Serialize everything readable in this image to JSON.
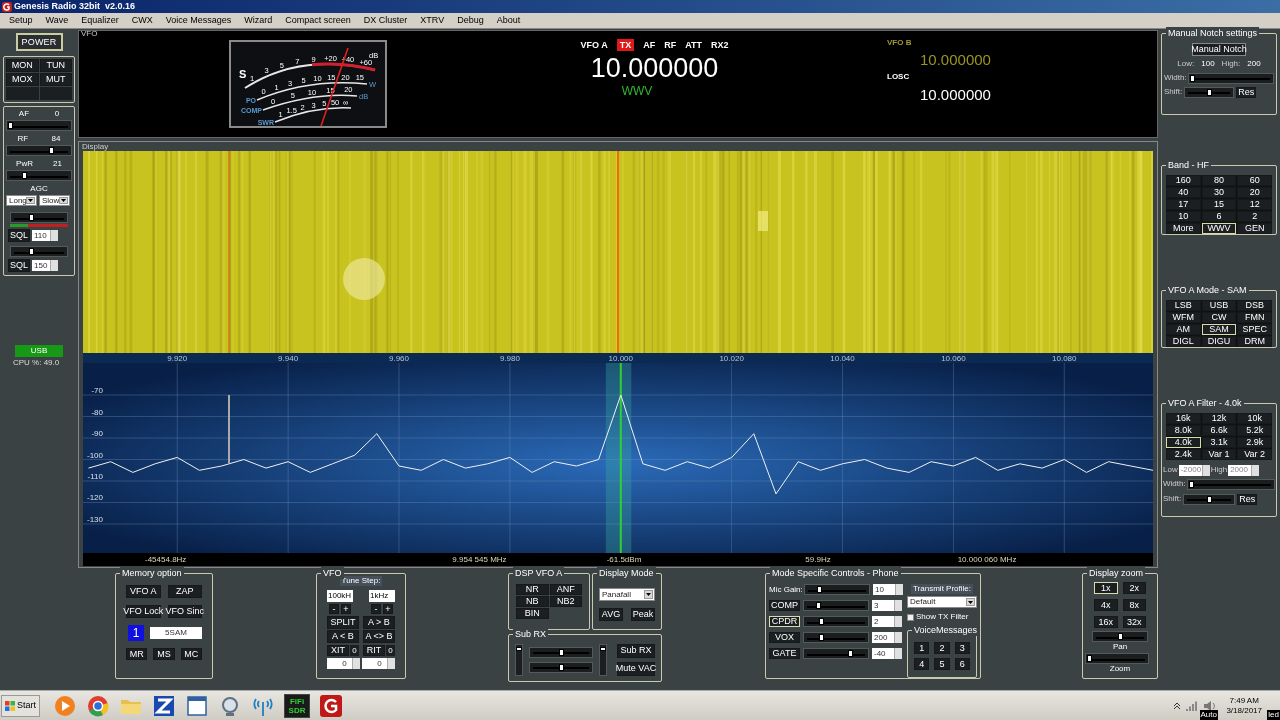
{
  "window": {
    "title": "Genesis Radio 32bit  v2.0.16"
  },
  "menu": [
    "Setup",
    "Wave",
    "Equalizer",
    "CWX",
    "Voice Messages",
    "Wizard",
    "Compact screen",
    "DX Cluster",
    "XTRV",
    "Debug",
    "About"
  ],
  "left_panel": {
    "power": "POWER",
    "buttons": [
      "MON",
      "TUN",
      "MOX",
      "MUT"
    ],
    "sliders": [
      {
        "label": "AF",
        "reading": "0",
        "level": 0.02
      },
      {
        "label": "RF",
        "reading": "84",
        "level": 0.72
      },
      {
        "label": "PwR",
        "reading": "21",
        "level": 0.25
      }
    ],
    "agc": {
      "label": "AGC",
      "mode": "Long",
      "speed": "Slow"
    },
    "squelch": [
      {
        "label": "SQL",
        "value": "110",
        "level": 0.35
      },
      {
        "label": "SQL",
        "value": "150",
        "level": 0.35
      }
    ],
    "mode_badge": "USB",
    "cpu": "CPU %: 49.0"
  },
  "vfo": {
    "label": "VFO",
    "meter": {
      "scales": [
        {
          "label": "S",
          "marks": [
            "1",
            "3",
            "5",
            "7",
            "9",
            "+20",
            "+40",
            "+60"
          ],
          "unit": "dB"
        },
        {
          "label": "PO",
          "marks": [
            "0",
            "1",
            "3",
            "5",
            "10",
            "15",
            "20",
            "15"
          ],
          "unit": "W"
        },
        {
          "label": "COMP",
          "marks": [
            "0",
            "5",
            "10",
            "15",
            "20"
          ],
          "unit": "dB"
        },
        {
          "label": "SWR",
          "marks": [
            "1",
            "1.5",
            "2",
            "3",
            "5",
            "50",
            "∞"
          ]
        }
      ]
    },
    "indicators": [
      {
        "label": "VFO A",
        "on": false
      },
      {
        "label": "TX",
        "on": true
      },
      {
        "label": "AF",
        "on": false
      },
      {
        "label": "RF",
        "on": false
      },
      {
        "label": "ATT",
        "on": false
      },
      {
        "label": "RX2",
        "on": false
      }
    ],
    "frequency": "10.000000",
    "station": "WWV",
    "vfo_b_label": "VFO B",
    "vfo_b_frequency": "10.000000",
    "losc_label": "LOSC",
    "losc_frequency": "10.000000"
  },
  "display": {
    "label": "Display",
    "chart_data": {
      "type": "line",
      "grid": true,
      "bands": [
        {
          "axis": "x",
          "from": 9.9973,
          "to": 10.0019,
          "color": "#3aa8a0"
        }
      ],
      "ref_lines": [
        {
          "axis": "x",
          "value": 10.0,
          "color": "#30d030"
        }
      ],
      "xlim": [
        9.903,
        10.096
      ],
      "ylim": [
        -143.5,
        -55.1
      ],
      "xticks": [
        {
          "value": 9.92,
          "label": "9.920"
        },
        {
          "value": 9.94,
          "label": "9.940"
        },
        {
          "value": 9.96,
          "label": "9.960"
        },
        {
          "value": 9.98,
          "label": "9.980"
        },
        {
          "value": 10.0,
          "label": "10.000"
        },
        {
          "value": 10.02,
          "label": "10.020"
        },
        {
          "value": 10.04,
          "label": "10.040"
        },
        {
          "value": 10.06,
          "label": "10.060"
        },
        {
          "value": 10.08,
          "label": "10.080"
        }
      ],
      "yticks": [
        -70,
        -80,
        -90,
        -100,
        -110,
        -120,
        -130
      ],
      "x": [
        9.904,
        9.908,
        9.912,
        9.916,
        9.92,
        9.924,
        9.928,
        9.932,
        9.936,
        9.94,
        9.944,
        9.948,
        9.952,
        9.956,
        9.96,
        9.964,
        9.968,
        9.972,
        9.976,
        9.98,
        9.984,
        9.988,
        9.992,
        9.996,
        10.0,
        10.004,
        10.008,
        10.012,
        10.016,
        10.02,
        10.024,
        10.028,
        10.032,
        10.036,
        10.04,
        10.044,
        10.048,
        10.052,
        10.056,
        10.06,
        10.064,
        10.068,
        10.072,
        10.076,
        10.08,
        10.084,
        10.088,
        10.092,
        10.096
      ],
      "series": [
        {
          "color": "#f0f0f0",
          "values": [
            -104,
            -101,
            -106,
            -102,
            -99,
            -105,
            -103,
            -100,
            -104,
            -101,
            -106,
            -102,
            -98,
            -88,
            -103,
            -105,
            -100,
            -104,
            -102,
            -99,
            -106,
            -101,
            -103,
            -100,
            -70,
            -102,
            -105,
            -101,
            -104,
            -99,
            -88,
            -116,
            -101,
            -105,
            -102,
            -100,
            -104,
            -106,
            -101,
            -103,
            -99,
            -105,
            -102,
            -104,
            -100,
            -106,
            -101,
            -103,
            -105
          ]
        }
      ]
    },
    "readouts": [
      "-45454.8Hz",
      "9.954 545 MHz",
      "-61.5dBm",
      "59.9Hz",
      "10.000 060 MHz"
    ]
  },
  "notch": {
    "title": "Manual Notch settings",
    "button": "Manual Notch",
    "low_label": "Low:",
    "low": "100",
    "high_label": "High:",
    "high": "200",
    "width": {
      "label": "Width:",
      "level": 0.02
    },
    "shift": {
      "label": "Shift:",
      "level": 0.5
    },
    "res": "Res"
  },
  "band": {
    "title": "Band - HF",
    "items": [
      {
        "label": "160",
        "selected": false
      },
      {
        "label": "80",
        "selected": false
      },
      {
        "label": "60",
        "selected": false
      },
      {
        "label": "40",
        "selected": false
      },
      {
        "label": "30",
        "selected": false
      },
      {
        "label": "20",
        "selected": false
      },
      {
        "label": "17",
        "selected": false
      },
      {
        "label": "15",
        "selected": false
      },
      {
        "label": "12",
        "selected": false
      },
      {
        "label": "10",
        "selected": false
      },
      {
        "label": "6",
        "selected": false
      },
      {
        "label": "2",
        "selected": false
      },
      {
        "label": "More",
        "selected": false
      },
      {
        "label": "WWV",
        "selected": true
      },
      {
        "label": "GEN",
        "selected": false
      }
    ]
  },
  "mode": {
    "title": "VFO A Mode - SAM",
    "items": [
      {
        "label": "LSB",
        "selected": false
      },
      {
        "label": "USB",
        "selected": false
      },
      {
        "label": "DSB",
        "selected": false
      },
      {
        "label": "WFM",
        "selected": false
      },
      {
        "label": "CW",
        "selected": false
      },
      {
        "label": "FMN",
        "selected": false
      },
      {
        "label": "AM",
        "selected": false
      },
      {
        "label": "SAM",
        "selected": true
      },
      {
        "label": "SPEC",
        "selected": false
      },
      {
        "label": "DIGL",
        "selected": false
      },
      {
        "label": "DIGU",
        "selected": false
      },
      {
        "label": "DRM",
        "selected": false
      }
    ]
  },
  "filter": {
    "title": "VFO A Filter - 4.0k",
    "items": [
      {
        "label": "16k",
        "selected": false
      },
      {
        "label": "12k",
        "selected": false
      },
      {
        "label": "10k",
        "selected": false
      },
      {
        "label": "8.0k",
        "selected": false
      },
      {
        "label": "6.6k",
        "selected": false
      },
      {
        "label": "5.2k",
        "selected": false
      },
      {
        "label": "4.0k",
        "selected": true
      },
      {
        "label": "3.1k",
        "selected": false
      },
      {
        "label": "2.9k",
        "selected": false
      },
      {
        "label": "2.4k",
        "selected": false
      },
      {
        "label": "Var 1",
        "selected": false
      },
      {
        "label": "Var 2",
        "selected": false
      }
    ],
    "low_label": "Low",
    "low": "-2000",
    "high_label": "High",
    "high": "2000",
    "width": {
      "label": "Width:",
      "level": 0.02
    },
    "shift": {
      "label": "Shift:",
      "level": 0.5
    },
    "res": "Res"
  },
  "memory": {
    "title": "Memory option",
    "buttons": [
      "VFO A",
      "ZAP",
      "VFO Lock",
      "VFO Sinc"
    ],
    "channel": "1",
    "name": "5SAM",
    "bottom_buttons": [
      "MR",
      "MS",
      "MC"
    ]
  },
  "vfo_controls": {
    "title": "VFO",
    "tune_step_label": "Tune Step:",
    "steps": [
      "100kH",
      "1kHz"
    ],
    "step_buttons": [
      "-",
      "+",
      "-",
      "+"
    ],
    "buttons": [
      "SPLIT",
      "A > B",
      "A < B",
      "A <> B"
    ],
    "offsets": [
      {
        "label": "XIT",
        "reading": "0",
        "value": "0"
      },
      {
        "label": "RIT",
        "reading": "0",
        "value": "0"
      }
    ]
  },
  "dsp": {
    "title": "DSP VFO A",
    "buttons": [
      "NR",
      "ANF",
      "NB",
      "NB2",
      "BIN"
    ]
  },
  "display_mode": {
    "title": "Display Mode",
    "value": "Panafall",
    "buttons": [
      "AVG",
      "Peak"
    ]
  },
  "sub_rx": {
    "title": "Sub RX",
    "vertical_sliders": [
      {
        "level": 0.9
      },
      {
        "level": 0.9
      }
    ],
    "horizontal_sliders": [
      {
        "level": 0.5
      },
      {
        "level": 0.5
      }
    ],
    "buttons": [
      "Sub RX",
      "Mute VAC"
    ]
  },
  "mode_controls": {
    "title": "Mode Specific Controls - Phone",
    "rows": [
      {
        "kind": "label",
        "label": "Mic Gain:",
        "level": 0.2,
        "value": "10"
      },
      {
        "kind": "button",
        "label": "COMP",
        "selected": false,
        "level": 0.2,
        "value": "3"
      },
      {
        "kind": "button",
        "label": "CPDR",
        "selected": true,
        "level": 0.25,
        "value": "2"
      },
      {
        "kind": "button",
        "label": "VOX",
        "selected": false,
        "level": 0.25,
        "value": "200"
      },
      {
        "kind": "button",
        "label": "GATE",
        "selected": false,
        "level": 0.75,
        "value": "-40"
      }
    ],
    "profile_label": "Transmit Profile:",
    "profile": "Default",
    "show_tx_filter": {
      "label": "Show TX Filter",
      "checked": false
    },
    "voice": {
      "title": "VoiceMessages",
      "buttons": [
        "1",
        "2",
        "3",
        "4",
        "5",
        "6"
      ]
    }
  },
  "zoom": {
    "title": "Display zoom",
    "buttons": [
      {
        "label": "1x",
        "selected": true
      },
      {
        "label": "2x",
        "selected": false
      },
      {
        "label": "4x",
        "selected": false
      },
      {
        "label": "8x",
        "selected": false
      },
      {
        "label": "16x",
        "selected": false
      },
      {
        "label": "32x",
        "selected": false
      }
    ],
    "pan": {
      "label": "Pan",
      "level": 0.5
    },
    "zoom_slider": {
      "label": "Zoom",
      "level": 0.02
    }
  },
  "taskbar": {
    "start": "Start",
    "apps": [
      {
        "kind": "media"
      },
      {
        "kind": "browser"
      },
      {
        "kind": "folder"
      },
      {
        "kind": "blue-z"
      },
      {
        "kind": "window"
      },
      {
        "kind": "magnifier"
      },
      {
        "kind": "antenna"
      },
      {
        "kind": "fifi",
        "label": "FiFi SDR"
      },
      {
        "kind": "genesis"
      }
    ],
    "time": "7:49 AM",
    "date": "3/18/2017",
    "overlays": [
      "Auto",
      "led"
    ]
  }
}
